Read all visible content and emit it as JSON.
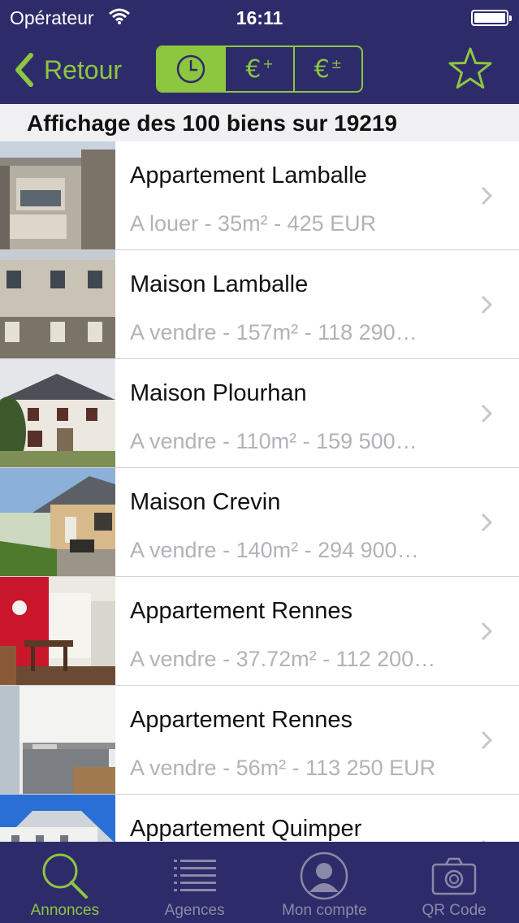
{
  "status": {
    "carrier": "Opérateur",
    "time": "16:11"
  },
  "nav": {
    "back_label": "Retour",
    "segments": [
      "clock-icon",
      "euro-up-icon",
      "euro-plusminus-icon"
    ],
    "favorite_icon": "star-icon"
  },
  "header": {
    "text": "Affichage des 100 biens sur 19219"
  },
  "listings": [
    {
      "title": "Appartement Lamballe",
      "subtitle": "A louer - 35m² - 425  EUR"
    },
    {
      "title": "Maison Lamballe",
      "subtitle": "A vendre - 157m² - 118 290…"
    },
    {
      "title": "Maison Plourhan",
      "subtitle": "A vendre - 110m² - 159 500…"
    },
    {
      "title": "Maison Crevin",
      "subtitle": "A vendre - 140m² - 294 900…"
    },
    {
      "title": "Appartement Rennes",
      "subtitle": "A vendre - 37.72m² - 112 200…"
    },
    {
      "title": "Appartement Rennes",
      "subtitle": "A vendre - 56m² - 113 250  EUR"
    },
    {
      "title": "Appartement Quimper",
      "subtitle": ""
    }
  ],
  "tabs": [
    {
      "label": "Annonces",
      "icon": "search-icon"
    },
    {
      "label": "Agences",
      "icon": "list-icon"
    },
    {
      "label": "Mon compte",
      "icon": "user-icon"
    },
    {
      "label": "QR Code",
      "icon": "camera-icon"
    }
  ],
  "colors": {
    "nav_bg": "#2e2b6b",
    "accent": "#8dc63f"
  }
}
